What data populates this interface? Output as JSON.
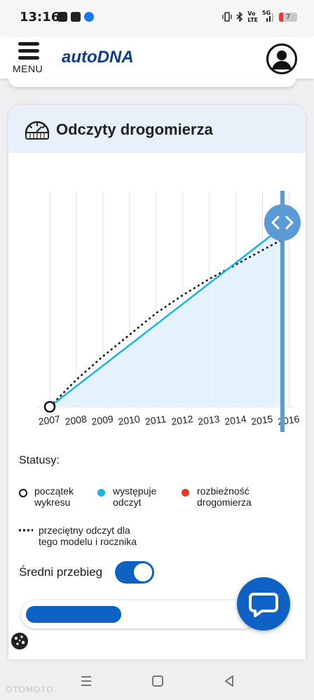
{
  "status_bar": {
    "time": "13:16",
    "volte": "Vo\nLTE",
    "network": "5G",
    "battery": "7"
  },
  "header": {
    "menu_label": "MENU",
    "logo": "autoDNA"
  },
  "card": {
    "title": "Odczyty drogomierza"
  },
  "chart_data": {
    "type": "line",
    "categories": [
      "2007",
      "2008",
      "2009",
      "2010",
      "2011",
      "2012",
      "2013",
      "2014",
      "2015",
      "2016"
    ],
    "series": [
      {
        "name": "występuje odczyt",
        "x": [
          2007,
          2015.75
        ],
        "y": [
          0,
          100
        ],
        "color": "#1ab2e8"
      },
      {
        "name": "przeciętny odczyt dla tego modelu i rocznika",
        "x": [
          2007,
          2008,
          2009,
          2010,
          2011,
          2012,
          2013,
          2014,
          2015,
          2015.75
        ],
        "y": [
          0,
          15,
          28,
          40,
          52,
          62,
          71,
          79,
          87,
          93
        ],
        "style": "dotted",
        "color": "#111111"
      }
    ],
    "start_point": {
      "x": 2007,
      "y": 0
    },
    "xlim": [
      2006.5,
      2016.2
    ],
    "ylim": [
      0,
      120
    ],
    "grid": "vertical",
    "slider_at": "2015.75"
  },
  "legend": {
    "heading": "Statusy:",
    "items": [
      {
        "line1": "początek",
        "line2": "wykresu",
        "color": "#111111",
        "kind": "ring"
      },
      {
        "line1": "występuje",
        "line2": "odczyt",
        "color": "#1ab2e8",
        "kind": "dot"
      },
      {
        "line1": "rozbieżność",
        "line2": "drogomierza",
        "color": "#e8391c",
        "kind": "dot"
      }
    ],
    "average": {
      "line1": "przeciętny odczyt dla",
      "line2": "tego modelu i rocznika"
    }
  },
  "average_mileage": {
    "label": "Średni przebieg",
    "enabled": true
  },
  "progress": {
    "fraction": 0.42
  },
  "watermark": "OTOMOTO"
}
